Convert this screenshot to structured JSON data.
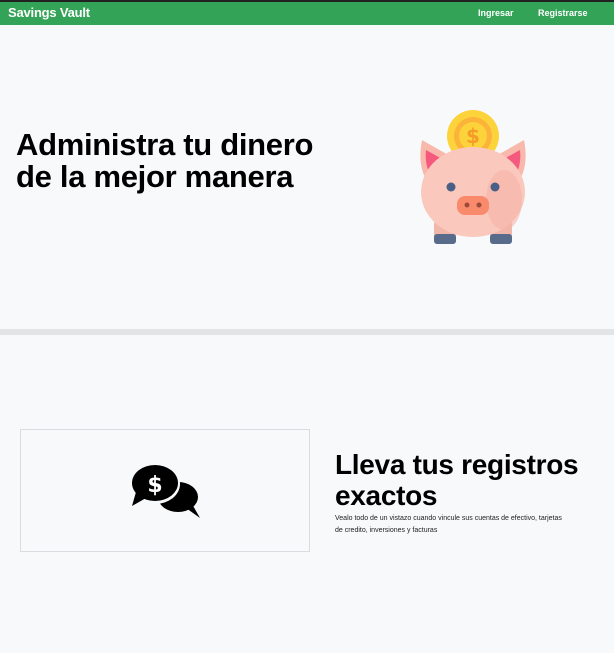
{
  "navbar": {
    "brand": "Savings Vault",
    "links": [
      "Ingresar",
      "Registrarse"
    ],
    "color": "#33a457"
  },
  "hero": {
    "title": "Administra tu dinero de la mejor manera",
    "image_icon": "piggy-bank-coin-icon"
  },
  "features": [
    {
      "icon": "money-chat-icon",
      "title": "Lleva tus registros exactos",
      "description": "Vealo todo de un vistazo cuando vincule sus cuentas de efectivo, tarjetas de credito, inversiones y facturas"
    }
  ]
}
